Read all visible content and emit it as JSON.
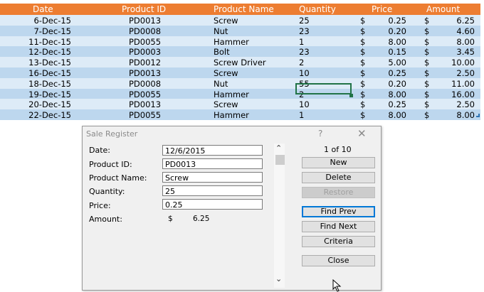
{
  "table": {
    "headers": [
      "Date",
      "Product ID",
      "Product Name",
      "Quantity",
      "Price",
      "Amount"
    ],
    "currency_symbol": "$",
    "rows": [
      {
        "date": "6-Dec-15",
        "pid": "PD0013",
        "name": "Screw",
        "qty": "25",
        "price": "0.25",
        "amount": "6.25"
      },
      {
        "date": "7-Dec-15",
        "pid": "PD0008",
        "name": "Nut",
        "qty": "23",
        "price": "0.20",
        "amount": "4.60"
      },
      {
        "date": "11-Dec-15",
        "pid": "PD0055",
        "name": "Hammer",
        "qty": "1",
        "price": "8.00",
        "amount": "8.00"
      },
      {
        "date": "12-Dec-15",
        "pid": "PD0003",
        "name": "Bolt",
        "qty": "23",
        "price": "0.15",
        "amount": "3.45"
      },
      {
        "date": "13-Dec-15",
        "pid": "PD0012",
        "name": "Screw Driver",
        "qty": "2",
        "price": "5.00",
        "amount": "10.00"
      },
      {
        "date": "16-Dec-15",
        "pid": "PD0013",
        "name": "Screw",
        "qty": "10",
        "price": "0.25",
        "amount": "2.50"
      },
      {
        "date": "18-Dec-15",
        "pid": "PD0008",
        "name": "Nut",
        "qty": "55",
        "price": "0.20",
        "amount": "11.00"
      },
      {
        "date": "19-Dec-15",
        "pid": "PD0055",
        "name": "Hammer",
        "qty": "2",
        "price": "8.00",
        "amount": "16.00"
      },
      {
        "date": "20-Dec-15",
        "pid": "PD0013",
        "name": "Screw",
        "qty": "10",
        "price": "0.25",
        "amount": "2.50"
      },
      {
        "date": "22-Dec-15",
        "pid": "PD0055",
        "name": "Hammer",
        "qty": "1",
        "price": "8.00",
        "amount": "8.00"
      }
    ],
    "colors": {
      "header_bg": "#ed7d31",
      "band_light": "#ddebf7",
      "band_dark": "#bdd7ee",
      "selection": "#217346"
    }
  },
  "dialog": {
    "title": "Sale Register",
    "help_glyph": "?",
    "close_glyph": "✕",
    "fields": {
      "date_label": "Date:",
      "date_value": "12/6/2015",
      "pid_label": "Product ID:",
      "pid_value": "PD0013",
      "pname_label": "Product Name:",
      "pname_value": "Screw",
      "qty_label": "Quantity:",
      "qty_value": "25",
      "price_label": "Price:",
      "price_value": "0.25",
      "amount_label": "Amount:",
      "amount_currency": "$",
      "amount_value": "6.25"
    },
    "record_counter": "1 of 10",
    "buttons": {
      "new": "New",
      "delete": "Delete",
      "restore": "Restore",
      "find_prev": "Find Prev",
      "find_next": "Find Next",
      "criteria": "Criteria",
      "close": "Close"
    },
    "scroll_up_glyph": "⌃",
    "scroll_down_glyph": "⌄"
  }
}
